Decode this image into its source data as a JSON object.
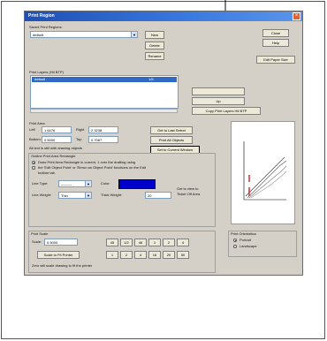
{
  "window": {
    "title": "Print Region",
    "close_glyph": "×"
  },
  "saved_regions": {
    "label": "Saved Print Regions:",
    "selected": "default",
    "new_button": "New",
    "delete_button": "Delete",
    "rename_button": "Rename"
  },
  "right_buttons": {
    "close": "Close",
    "help": "Help",
    "edit_paper": "Edit Paper Size"
  },
  "layers_list": {
    "label": "Print Layers (Hit BTP)",
    "selected_row": "default",
    "selected_row_value": "1/8"
  },
  "layer_buttons": {
    "b1": "",
    "b2": "Up",
    "copy": "Copy Print Layers Hit BTP"
  },
  "print_area": {
    "label": "Print Area",
    "left_label": "Left",
    "left_value": "1.6476",
    "right_label": "Right",
    "right_value": "2.3238",
    "bottom_label": "Bottom",
    "bottom_value": "0.5000",
    "top_label": "Top",
    "top_value": "0.7087",
    "note": "All text is still with drawing objects",
    "btn_last": "Get to Last Select",
    "btn_all": "Print All Objects",
    "btn_current": "Set to Current Window"
  },
  "outline": {
    "label": "Outline Print Area Rectangle",
    "opt1": "Draw Print Area Rectangle in current, 1 over the drafting using",
    "opt1_b": "the 'Edit Object Point' or 'Rerun an Object Point' functions on the Edit",
    "opt1_c": "toolbar tab.",
    "opt2": "",
    "line_type_label": "Line Type:",
    "line_type_value": "———",
    "color_label": "Color:",
    "color_value": "#0000cc",
    "line_weight_label": "Line Weight:",
    "line_weight_value": "Thin",
    "thick_label": "Thick Weight:",
    "thick_value": "20",
    "side_note_a": "Get to view to",
    "side_note_b": "Ticket Off Area"
  },
  "scale": {
    "label": "Print Scale",
    "scale_label": "Scale:",
    "scale_value": "0.5000",
    "fit_button": "Scale to Fit Printer",
    "row1": [
      "45",
      "1/2",
      "46",
      "1",
      "2",
      "4"
    ],
    "row2": [
      "1",
      "2",
      "4",
      "16",
      "20",
      "50"
    ],
    "note": "Zero will scale drawing to fit the printer"
  },
  "orientation": {
    "label": "Print Orientation",
    "portrait": "Portrait",
    "landscape": "Landscape",
    "selected": "portrait"
  }
}
